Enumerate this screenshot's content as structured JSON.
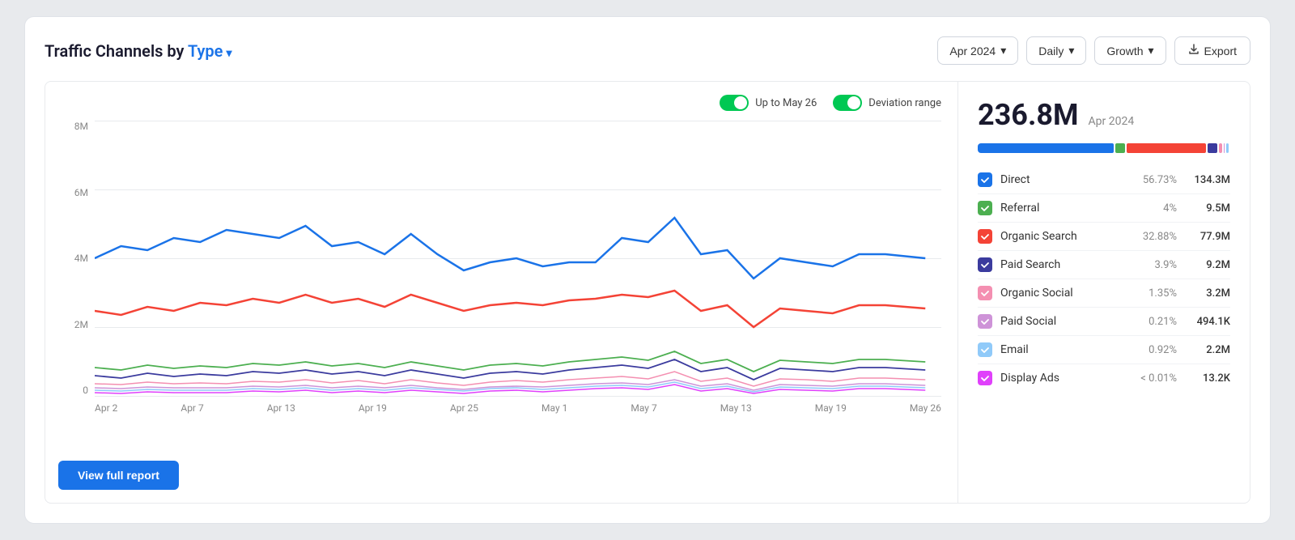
{
  "header": {
    "title_prefix": "Traffic Channels by ",
    "title_type": "Type",
    "chevron": "▾"
  },
  "controls": {
    "date_label": "Apr 2024",
    "frequency_label": "Daily",
    "metric_label": "Growth",
    "export_label": "Export"
  },
  "toggles": {
    "up_to_label": "Up to May 26",
    "deviation_label": "Deviation range"
  },
  "chart": {
    "y_axis": [
      "8M",
      "6M",
      "4M",
      "2M",
      "0"
    ],
    "x_axis": [
      "Apr 2",
      "Apr 7",
      "Apr 13",
      "Apr 19",
      "Apr 25",
      "May 1",
      "May 7",
      "May 13",
      "May 19",
      "May 26"
    ]
  },
  "view_report": {
    "label": "View full report"
  },
  "legend": {
    "total_value": "236.8M",
    "total_period": "Apr 2024",
    "items": [
      {
        "name": "Direct",
        "color": "#1a73e8",
        "pct": "56.73%",
        "value": "134.3M",
        "bar_pct": 56.73
      },
      {
        "name": "Referral",
        "color": "#4caf50",
        "pct": "4%",
        "value": "9.5M",
        "bar_pct": 4
      },
      {
        "name": "Organic Search",
        "color": "#f44336",
        "pct": "32.88%",
        "value": "77.9M",
        "bar_pct": 32.88
      },
      {
        "name": "Paid Search",
        "color": "#3b3b9e",
        "pct": "3.9%",
        "value": "9.2M",
        "bar_pct": 3.9
      },
      {
        "name": "Organic Social",
        "color": "#f48fb1",
        "pct": "1.35%",
        "value": "3.2M",
        "bar_pct": 1.35
      },
      {
        "name": "Paid Social",
        "color": "#ce93d8",
        "pct": "0.21%",
        "value": "494.1K",
        "bar_pct": 0.21
      },
      {
        "name": "Email",
        "color": "#90caf9",
        "pct": "0.92%",
        "value": "2.2M",
        "bar_pct": 0.92
      },
      {
        "name": "Display Ads",
        "color": "#e040fb",
        "pct": "< 0.01%",
        "value": "13.2K",
        "bar_pct": 0.01
      }
    ]
  }
}
